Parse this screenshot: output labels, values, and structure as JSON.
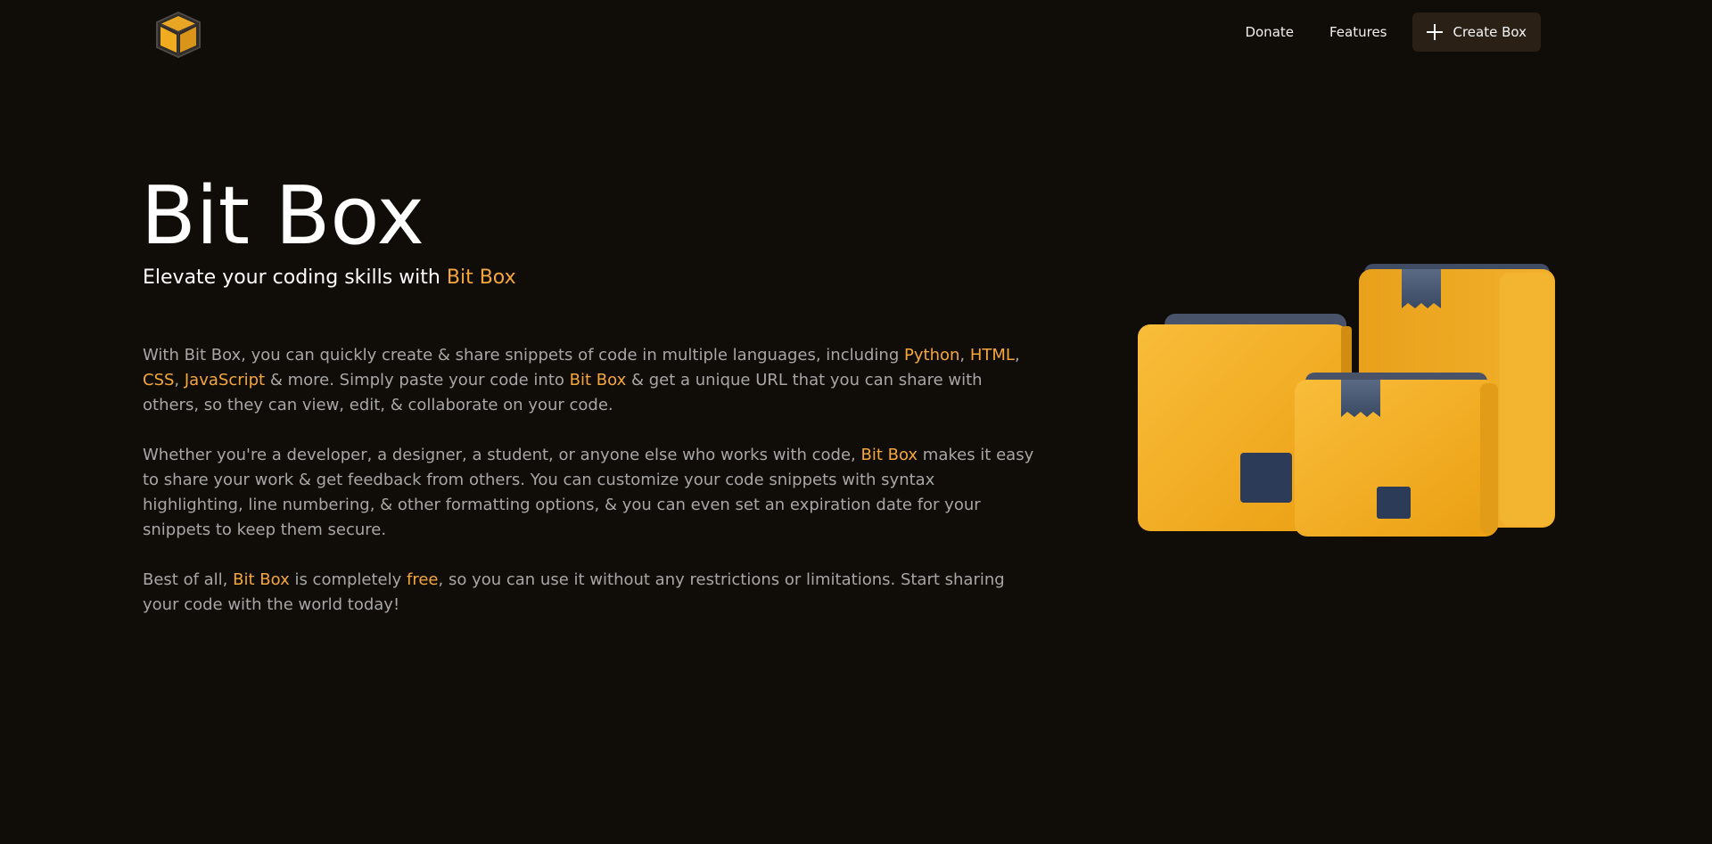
{
  "nav": {
    "logo_icon": "cube-logo-icon",
    "links": [
      {
        "label": "Donate"
      },
      {
        "label": "Features"
      }
    ],
    "create_button": {
      "label": "Create Box",
      "icon": "plus-icon"
    }
  },
  "hero": {
    "title": "Bit Box",
    "subtitle_prefix": "Elevate your coding skills with ",
    "subtitle_highlight": "Bit Box"
  },
  "paragraphs": {
    "p1": {
      "a": "With Bit Box, you can quickly create & share snippets of code in multiple languages, including ",
      "python": "Python",
      "c1": ", ",
      "html": "HTML",
      "c2": ", ",
      "css": "CSS",
      "c3": ", ",
      "js": "JavaScript",
      "b": " & more. Simply paste your code into ",
      "bitbox": "Bit Box",
      "c": " & get a unique URL that you can share with others, so they can view, edit, & collaborate on your code."
    },
    "p2": {
      "a": "Whether you're a developer, a designer, a student, or anyone else who works with code, ",
      "bitbox": "Bit Box",
      "b": " makes it easy to share your work & get feedback from others. You can customize your code snippets with syntax highlighting, line numbering, & other formatting options, & you can even set an expiration date for your snippets to keep them secure."
    },
    "p3": {
      "a": "Best of all, ",
      "bitbox": "Bit Box",
      "b": " is completely ",
      "free": "free",
      "c": ", so you can use it without any restrictions or limitations. Start sharing your code with the world today!"
    }
  },
  "illustration": {
    "icon": "cardboard-boxes-illustration"
  },
  "colors": {
    "background": "#100c07",
    "accent": "#f5a73b",
    "body_text": "#a7a7a7",
    "button_bg": "#2b2016"
  }
}
